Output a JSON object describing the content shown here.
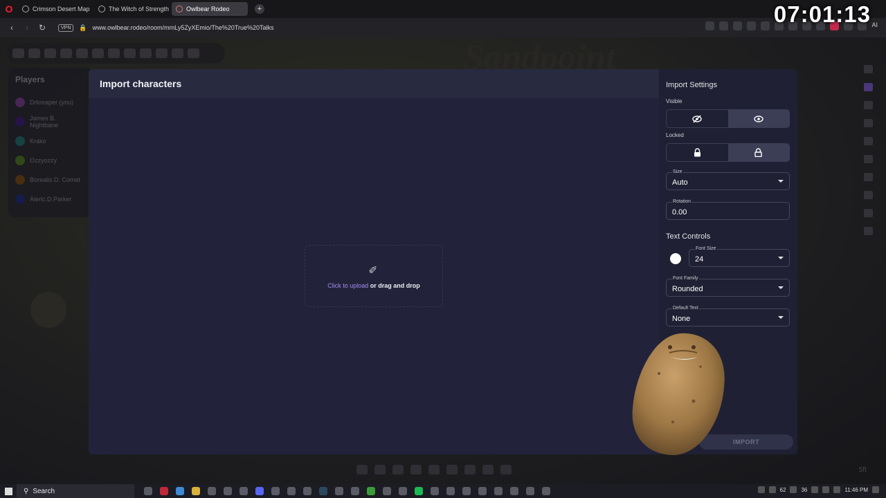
{
  "browser": {
    "tabs": [
      {
        "label": "Crimson Desert Map | Ma",
        "active": false
      },
      {
        "label": "The Witch of Strength | Fa",
        "active": false
      },
      {
        "label": "Owlbear Rodeo",
        "active": true
      }
    ],
    "new_tab_symbol": "+",
    "vpn_label": "VPN",
    "url": "www.owlbear.rodeo/room/mmLy5ZyXEmio/The%20True%20Talks",
    "ai_label": "AI"
  },
  "overlay_clock": "07:01:13",
  "background": {
    "map_title": "Sandpoint",
    "players_title": "Players",
    "players": [
      {
        "name": "Drkreaper (you)",
        "color": "#7b3f8f"
      },
      {
        "name": "James B. Nightbane",
        "color": "#3b1a7a"
      },
      {
        "name": "Krako",
        "color": "#1f6f6f"
      },
      {
        "name": "Ozzyozzy",
        "color": "#4f7a1f"
      },
      {
        "name": "Borealis D. Comet",
        "color": "#7a4a14"
      },
      {
        "name": "Aleric.D.Parker",
        "color": "#1e2b7a"
      }
    ],
    "grid_size": "5ft"
  },
  "dialog": {
    "title": "Import characters",
    "upload": {
      "link_text": "Click to upload",
      "rest_text": " or drag and drop"
    },
    "settings": {
      "title": "Import Settings",
      "visible_label": "Visible",
      "locked_label": "Locked",
      "size": {
        "label": "Size",
        "value": "Auto"
      },
      "rotation": {
        "label": "Rotation",
        "value": "0.00"
      },
      "text_controls_title": "Text Controls",
      "text_color": "#ffffff",
      "font_size": {
        "label": "Font Size",
        "value": "24"
      },
      "font_family": {
        "label": "Font Family",
        "value": "Rounded"
      },
      "default_text": {
        "label": "Default Text",
        "value": "None"
      },
      "import_button": "IMPORT"
    }
  },
  "taskbar": {
    "search_label": "Search",
    "tray_numbers": [
      "62",
      "36"
    ],
    "time": "11:46 PM"
  },
  "colors": {
    "accent": "#a58cf0",
    "dialog_bg": "#22233a",
    "settings_bg": "#1f2033"
  }
}
